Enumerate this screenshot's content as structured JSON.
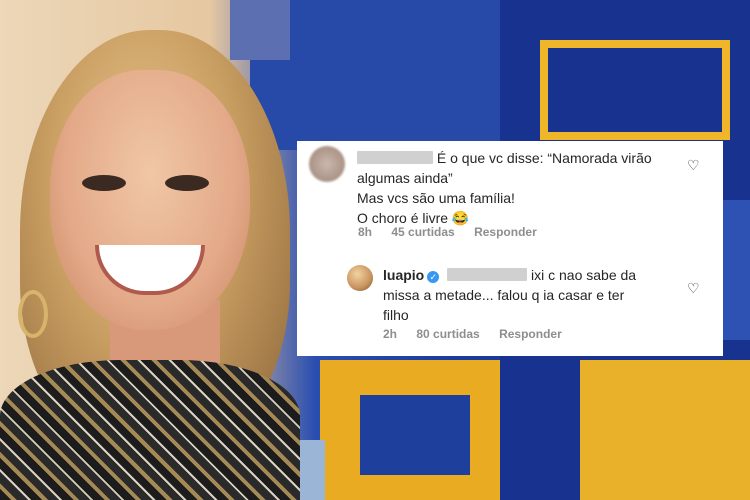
{
  "comments": [
    {
      "line1": "É o que vc disse: “Namorada virão",
      "line2": "algumas ainda”",
      "line3": "Mas vcs são uma família!",
      "line4": "O choro é livre 😂",
      "time": "8h",
      "likes": "45 curtidas",
      "reply": "Responder",
      "icon": "heart-icon"
    },
    {
      "username": "luapio",
      "line1": "ixi c nao sabe da",
      "line2": "missa a metade... falou q ia casar e ter",
      "line3": "filho",
      "time": "2h",
      "likes": "80 curtidas",
      "reply": "Responder",
      "icon": "heart-icon"
    }
  ],
  "colors": {
    "card_bg": "#ffffff",
    "text": "#262626",
    "meta": "#8e8e8e",
    "verified": "#3897f0"
  }
}
